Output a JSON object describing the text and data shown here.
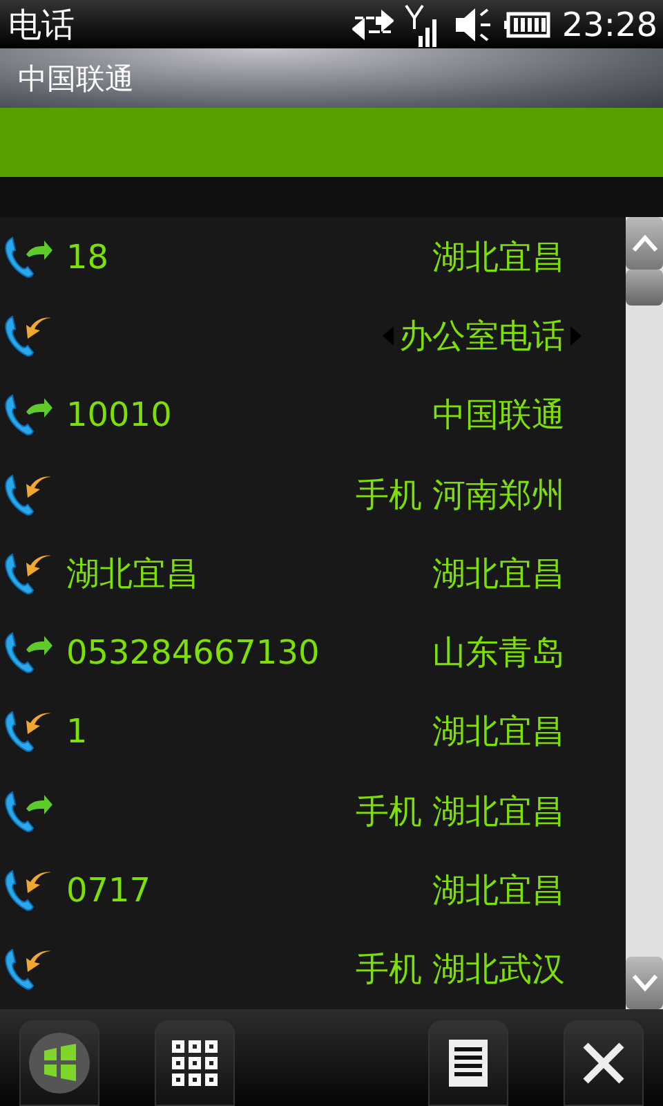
{
  "status_bar": {
    "app_title": "电话",
    "time": "23:28"
  },
  "header": {
    "carrier": "中国联通"
  },
  "calls": [
    {
      "kind": "outgoing",
      "number": "18",
      "label": "湖北宜昌",
      "selected": false
    },
    {
      "kind": "incoming",
      "label": "办公室电话",
      "selected": true
    },
    {
      "kind": "outgoing",
      "number": "10010",
      "label": "中国联通",
      "selected": false
    },
    {
      "kind": "incoming",
      "label": "手机 河南郑州",
      "selected": false
    },
    {
      "kind": "incoming",
      "number": "湖北宜昌",
      "label": "湖北宜昌",
      "selected": false
    },
    {
      "kind": "outgoing",
      "number": "053284667130",
      "label": "山东青岛",
      "selected": false
    },
    {
      "kind": "incoming",
      "number": "1",
      "label": "湖北宜昌",
      "selected": false
    },
    {
      "kind": "outgoing",
      "label": "手机 湖北宜昌",
      "selected": false
    },
    {
      "kind": "incoming",
      "number": "0717",
      "label": "湖北宜昌",
      "selected": false
    },
    {
      "kind": "incoming",
      "label": "手机 湖北武汉",
      "selected": false
    }
  ]
}
